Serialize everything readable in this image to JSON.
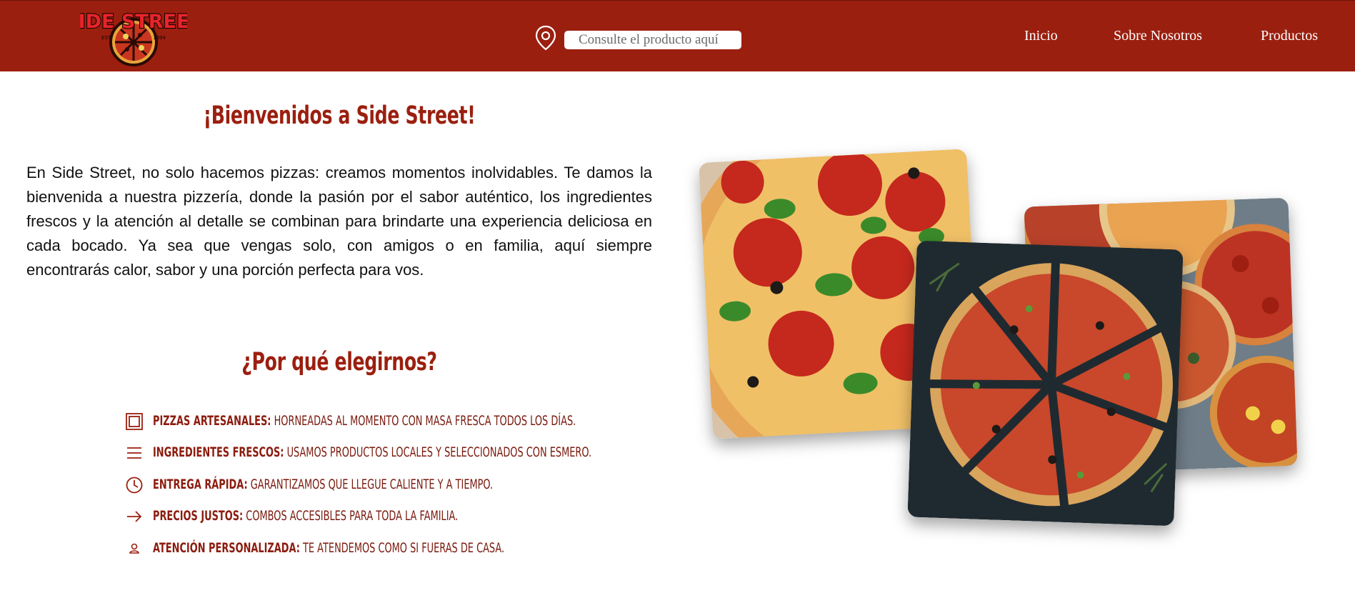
{
  "header": {
    "logo": {
      "text": "SIDE STREET",
      "est": "EST",
      "year": "1994",
      "icon": "pizza-logo"
    },
    "search": {
      "icon": "location-pin-icon",
      "placeholder": "Consulte el producto aquí",
      "value": ""
    },
    "nav": [
      {
        "label": "Inicio"
      },
      {
        "label": "Sobre Nosotros"
      },
      {
        "label": "Productos"
      }
    ]
  },
  "welcome": {
    "title": "¡Bienvenidos a Side Street!",
    "text": "En Side Street, no solo hacemos pizzas: creamos momentos inolvidables. Te damos la bienvenida a nuestra pizzería, donde la pasión por el sabor auténtico, los ingredientes frescos y la atención al detalle se combinan para brindarte una experiencia deliciosa en cada bocado. Ya sea que vengas solo, con amigos o en familia, aquí siempre encontrarás calor, sabor y una porción perfecta para vos."
  },
  "why": {
    "title": "¿Por qué elegirnos?",
    "items": [
      {
        "icon": "square-frame-icon",
        "title": "Pizzas artesanales:",
        "text": " Horneadas al momento con masa fresca todos los días."
      },
      {
        "icon": "menu-lines-icon",
        "title": "Ingredientes frescos:",
        "text": " Usamos productos locales y seleccionados con esmero."
      },
      {
        "icon": "clock-icon",
        "title": "Entrega rápida:",
        "text": " Garantizamos que llegue caliente y a tiempo."
      },
      {
        "icon": "arrow-right-icon",
        "title": "Precios justos:",
        "text": " Combos accesibles para toda la familia."
      },
      {
        "icon": "user-icon",
        "title": "Atención personalizada:",
        "text": " Te atendemos como si fueras de casa."
      }
    ]
  },
  "gallery": [
    {
      "name": "pepperoni-pizza-photo"
    },
    {
      "name": "multiple-pizzas-photo"
    },
    {
      "name": "sliced-pizza-photo"
    }
  ],
  "colors": {
    "brand": "#9b1f0f",
    "text": "#111111",
    "feature_text": "#7a1a0e"
  }
}
